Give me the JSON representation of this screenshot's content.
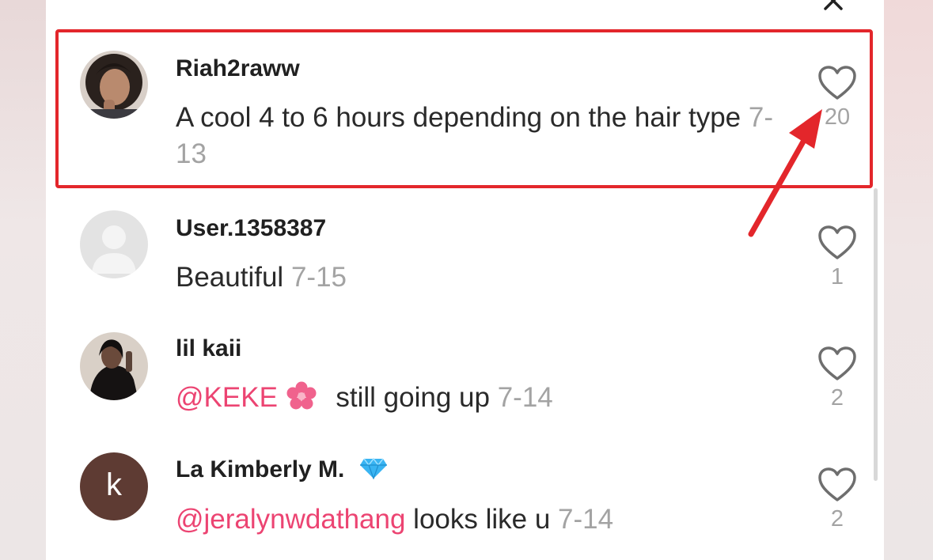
{
  "colors": {
    "highlight": "#e3262b",
    "mention": "#ec4472",
    "date": "#a3a3a3"
  },
  "comments": [
    {
      "username": "Riah2raww",
      "text": "A cool 4 to 6 hours depending on the hair type",
      "date": "7-13",
      "likes": "20"
    },
    {
      "username": "User.1358387",
      "text": "Beautiful",
      "date": "7-15",
      "likes": "1"
    },
    {
      "username": "lil kaii",
      "mention": "@KEKE",
      "text": "still going up",
      "date": "7-14",
      "likes": "2"
    },
    {
      "username": "La Kimberly M.",
      "avatar_letter": "k",
      "mention": "@jeralynwdathang",
      "text": "looks like u",
      "date": "7-14",
      "likes": "2"
    }
  ]
}
